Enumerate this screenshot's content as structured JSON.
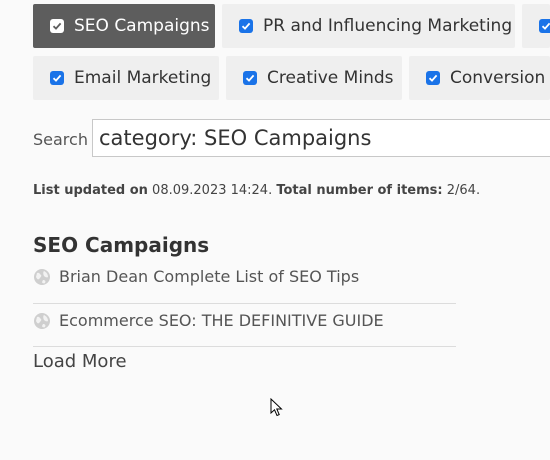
{
  "filters": [
    {
      "label": "SEO Campaigns",
      "checked": true,
      "active": true
    },
    {
      "label": "PR and Influencing Marketing",
      "checked": true,
      "active": false
    },
    {
      "label": "",
      "checked": true,
      "active": false
    },
    {
      "label": "Email Marketing",
      "checked": true,
      "active": false
    },
    {
      "label": "Creative Minds",
      "checked": true,
      "active": false
    },
    {
      "label": "Conversion O",
      "checked": true,
      "active": false
    }
  ],
  "search": {
    "label": "Search",
    "value": "category: SEO Campaigns"
  },
  "status": {
    "updated_label": "List updated on",
    "updated_value": "08.09.2023 14:24",
    "total_label": "Total number of items:",
    "total_value": "2/64"
  },
  "section": {
    "title": "SEO Campaigns",
    "items": [
      {
        "icon": "globe-icon",
        "label": "Brian Dean Complete List of SEO Tips"
      },
      {
        "icon": "globe-icon",
        "label": "Ecommerce SEO: THE DEFINITIVE GUIDE"
      }
    ]
  },
  "load_more": "Load More",
  "colors": {
    "active_chip": "#5d5d5d",
    "chip": "#efefef",
    "checkbox": "#1a73e8"
  }
}
